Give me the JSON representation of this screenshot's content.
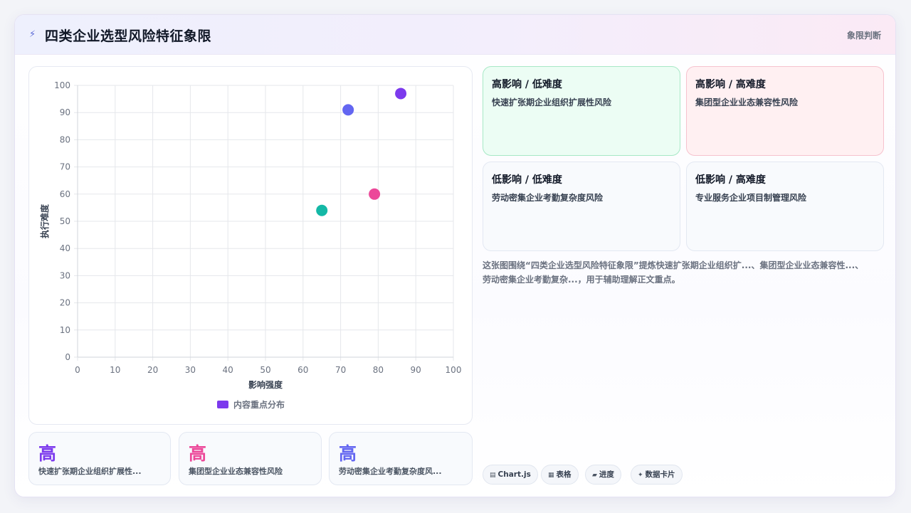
{
  "header": {
    "icon": "lightning-icon",
    "title": "四类企业选型风险特征象限",
    "tag": "象限判断"
  },
  "chart_data": {
    "type": "scatter",
    "xlabel": "影响强度",
    "ylabel": "执行难度",
    "xlim": [
      0,
      100
    ],
    "ylim": [
      0,
      100
    ],
    "xticks": [
      0,
      10,
      20,
      30,
      40,
      50,
      60,
      70,
      80,
      90,
      100
    ],
    "yticks": [
      0,
      10,
      20,
      30,
      40,
      50,
      60,
      70,
      80,
      90,
      100
    ],
    "grid": true,
    "legend_position": "bottom",
    "legend_label": "内容重点分布",
    "legend_color": "#7c3aed",
    "points": [
      {
        "x": 72,
        "y": 91,
        "color": "#6366f1"
      },
      {
        "x": 86,
        "y": 97,
        "color": "#7c3aed"
      },
      {
        "x": 79,
        "y": 60,
        "color": "#ec4899"
      },
      {
        "x": 65,
        "y": 54,
        "color": "#14b8a6"
      }
    ]
  },
  "stats": [
    {
      "value": "高",
      "label": "快速扩张期企业组织扩展性...",
      "color": "#7c3aed"
    },
    {
      "value": "高",
      "label": "集团型企业业态兼容性风险",
      "color": "#ec4899"
    },
    {
      "value": "高",
      "label": "劳动密集企业考勤复杂度风...",
      "color": "#6366f1"
    }
  ],
  "quadrants": [
    {
      "title": "高影响 / 低难度",
      "item": "快速扩张期企业组织扩展性风险"
    },
    {
      "title": "高影响 / 高难度",
      "item": "集团型企业业态兼容性风险"
    },
    {
      "title": "低影响 / 低难度",
      "item": "劳动密集企业考勤复杂度风险"
    },
    {
      "title": "低影响 / 高难度",
      "item": "专业服务企业项目制管理风险"
    }
  ],
  "description": "这张图围绕“四类企业选型风险特征象限”提炼快速扩张期企业组织扩...、集团型企业业态兼容性...、劳动密集企业考勤复杂...，用于辅助理解正文重点。",
  "chips": [
    {
      "icon": "chart-icon",
      "glyph": "▤",
      "label": "Chart.js"
    },
    {
      "icon": "table-icon",
      "glyph": "▦",
      "label": "表格"
    },
    {
      "icon": "progress-icon",
      "glyph": "▰",
      "label": "进度"
    },
    {
      "icon": "sparkle-icon",
      "glyph": "✦",
      "label": "数据卡片"
    }
  ]
}
